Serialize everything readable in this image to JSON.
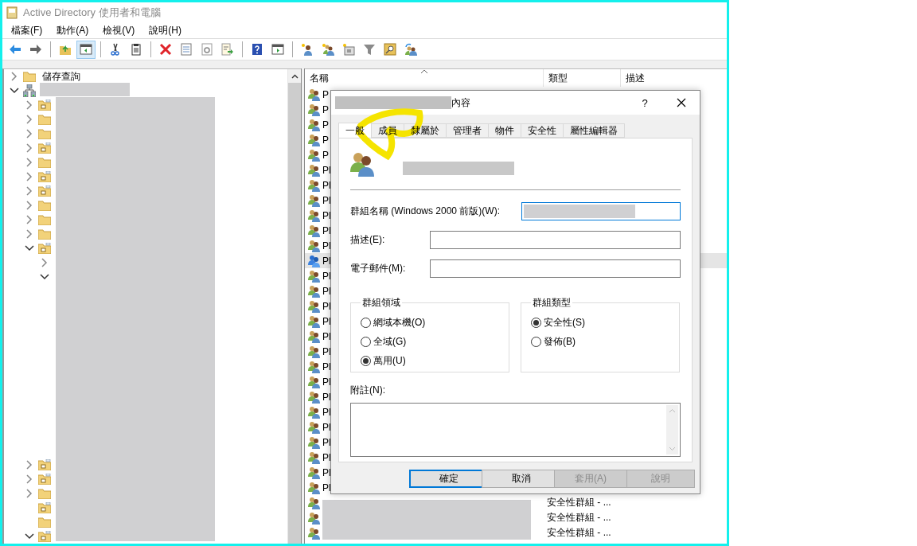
{
  "window": {
    "title": "Active Directory 使用者和電腦"
  },
  "menu": [
    "檔案(F)",
    "動作(A)",
    "檢視(V)",
    "說明(H)"
  ],
  "toolbar": [
    {
      "kind": "back",
      "pressed": false
    },
    {
      "kind": "forward",
      "pressed": false
    },
    {
      "kind": "sep"
    },
    {
      "kind": "up",
      "pressed": false
    },
    {
      "kind": "tree",
      "pressed": true
    },
    {
      "kind": "sep"
    },
    {
      "kind": "cut",
      "pressed": false
    },
    {
      "kind": "paste",
      "pressed": false
    },
    {
      "kind": "sep"
    },
    {
      "kind": "delete",
      "pressed": false
    },
    {
      "kind": "props",
      "pressed": false
    },
    {
      "kind": "refresh",
      "pressed": false
    },
    {
      "kind": "export",
      "pressed": false
    },
    {
      "kind": "sep"
    },
    {
      "kind": "help",
      "pressed": false
    },
    {
      "kind": "pane",
      "pressed": false
    },
    {
      "kind": "sep"
    },
    {
      "kind": "newuser",
      "pressed": false
    },
    {
      "kind": "newgroup",
      "pressed": false
    },
    {
      "kind": "newou",
      "pressed": false
    },
    {
      "kind": "filter",
      "pressed": false
    },
    {
      "kind": "find",
      "pressed": false
    },
    {
      "kind": "addgroup",
      "pressed": false
    }
  ],
  "tree": [
    {
      "kind": "folder",
      "label": "儲存查詢",
      "expanded": false
    },
    {
      "kind": "domain",
      "expanded": true,
      "children": [
        {
          "kind": "ou",
          "expanded": false
        },
        {
          "kind": "folder",
          "expanded": false
        },
        {
          "kind": "folder",
          "expanded": false
        },
        {
          "kind": "ou",
          "expanded": false
        },
        {
          "kind": "folder",
          "expanded": false
        },
        {
          "kind": "ou",
          "expanded": false
        },
        {
          "kind": "ou",
          "expanded": false
        },
        {
          "kind": "folder",
          "expanded": false
        },
        {
          "kind": "folder",
          "expanded": false
        },
        {
          "kind": "folder",
          "expanded": false
        },
        {
          "kind": "ou",
          "expanded": true,
          "children": [
            {
              "expanded": false
            },
            {
              "expanded": true
            }
          ]
        },
        {
          "kind": "ou",
          "expanded": false
        },
        {
          "kind": "ou",
          "expanded": false
        },
        {
          "kind": "folder",
          "expanded": false
        },
        {
          "kind": "ou"
        },
        {
          "kind": "folder"
        },
        {
          "kind": "ou",
          "expanded": true
        }
      ]
    }
  ],
  "list": {
    "columns": [
      "名稱",
      "類型",
      "描述"
    ],
    "rows": [
      {
        "kind": "group",
        "name": "P",
        "selected": false
      },
      {
        "kind": "group",
        "name": "P",
        "selected": false
      },
      {
        "kind": "group",
        "name": "P",
        "selected": false
      },
      {
        "kind": "group",
        "name": "P",
        "selected": false
      },
      {
        "kind": "group",
        "name": "P",
        "selected": false
      },
      {
        "kind": "group",
        "name": "Pl",
        "selected": false
      },
      {
        "kind": "group",
        "name": "Pl",
        "selected": false
      },
      {
        "kind": "group",
        "name": "Pl",
        "selected": false
      },
      {
        "kind": "group",
        "name": "Pl",
        "selected": false
      },
      {
        "kind": "group",
        "name": "Pl",
        "selected": false
      },
      {
        "kind": "group",
        "name": "Pl",
        "selected": false
      },
      {
        "kind": "group-alt",
        "name": "Pl",
        "selected": true
      },
      {
        "kind": "group",
        "name": "Pl",
        "selected": false
      },
      {
        "kind": "group",
        "name": "Pl",
        "selected": false
      },
      {
        "kind": "group",
        "name": "Pl",
        "selected": false
      },
      {
        "kind": "group",
        "name": "Pl",
        "selected": false
      },
      {
        "kind": "group",
        "name": "Pl",
        "selected": false
      },
      {
        "kind": "group",
        "name": "Pl",
        "selected": false
      },
      {
        "kind": "group",
        "name": "Pl",
        "selected": false
      },
      {
        "kind": "group",
        "name": "Pl",
        "selected": false
      },
      {
        "kind": "group",
        "name": "Pl",
        "selected": false
      },
      {
        "kind": "group",
        "name": "Pl",
        "selected": false
      },
      {
        "kind": "group",
        "name": "Pl",
        "selected": false
      },
      {
        "kind": "group",
        "name": "Pl",
        "selected": false
      },
      {
        "kind": "group",
        "name": "Pl",
        "selected": false
      },
      {
        "kind": "group",
        "name": "Pl",
        "selected": false
      },
      {
        "kind": "group",
        "name": "Pl",
        "selected": false
      },
      {
        "kind": "group",
        "selected": false,
        "type": "安全性群組 - ..."
      },
      {
        "kind": "group",
        "selected": false,
        "type": "安全性群組 - ..."
      },
      {
        "kind": "group",
        "selected": false,
        "type": "安全性群組 - ..."
      }
    ]
  },
  "dialog": {
    "title": "內容",
    "help": "?",
    "tabs": [
      {
        "label": "一般",
        "selected": true
      },
      {
        "label": "成員",
        "selected": false
      },
      {
        "label": "隸屬於",
        "selected": false
      },
      {
        "label": "管理者",
        "selected": false
      },
      {
        "label": "物件",
        "selected": false
      },
      {
        "label": "安全性",
        "selected": false
      },
      {
        "label": "屬性編輯器",
        "selected": false
      }
    ],
    "fields": [
      {
        "label": "群組名稱 (Windows 2000 前版)(W):",
        "focused": true,
        "kind": "redacted"
      },
      {
        "label": "描述(E):",
        "focused": false,
        "kind": "empty"
      },
      {
        "label": "電子郵件(M):",
        "focused": false,
        "kind": "empty"
      }
    ],
    "groups": [
      {
        "title": "群組領域",
        "options": [
          {
            "label": "網域本機(O)",
            "selected": false
          },
          {
            "label": "全域(G)",
            "selected": false
          },
          {
            "label": "萬用(U)",
            "selected": true
          }
        ]
      },
      {
        "title": "群組類型",
        "options": [
          {
            "label": "安全性(S)",
            "selected": true
          },
          {
            "label": "發佈(B)",
            "selected": false
          }
        ]
      }
    ],
    "notes_label": "附註(N):",
    "buttons": [
      {
        "label": "確定",
        "focused": true,
        "disabled": false
      },
      {
        "label": "取消",
        "focused": false,
        "disabled": false
      },
      {
        "label": "套用(A)",
        "focused": false,
        "disabled": true
      },
      {
        "label": "說明",
        "focused": false,
        "disabled": true
      }
    ]
  }
}
